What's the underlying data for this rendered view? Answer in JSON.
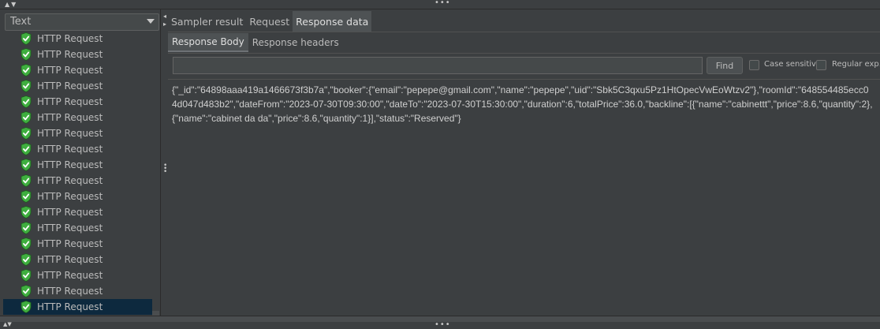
{
  "renderer_select": {
    "value": "Text"
  },
  "tree": {
    "items": [
      "HTTP Request",
      "HTTP Request",
      "HTTP Request",
      "HTTP Request",
      "HTTP Request",
      "HTTP Request",
      "HTTP Request",
      "HTTP Request",
      "HTTP Request",
      "HTTP Request",
      "HTTP Request",
      "HTTP Request",
      "HTTP Request",
      "HTTP Request",
      "HTTP Request",
      "HTTP Request",
      "HTTP Request",
      "HTTP Request"
    ],
    "item_icon": "green-shield-check-icon",
    "selected_index": 17
  },
  "tabs": [
    "Sampler result",
    "Request",
    "Response data"
  ],
  "active_tab": "Response data",
  "subtabs": [
    "Response Body",
    "Response headers"
  ],
  "active_subtab": "Response Body",
  "search": {
    "value": "",
    "find_label": "Find",
    "case_sensitive_label": "Case sensitive",
    "regex_label": "Regular exp."
  },
  "response_body": "{\"_id\":\"64898aaa419a1466673f3b7a\",\"booker\":{\"email\":\"pepepe@gmail.com\",\"name\":\"pepepe\",\"uid\":\"Sbk5C3qxu5Pz1HtOpecVwEoWtzv2\"},\"roomId\":\"648554485ecc04d047d483b2\",\"dateFrom\":\"2023-07-30T09:30:00\",\"dateTo\":\"2023-07-30T15:30:00\",\"duration\":6,\"totalPrice\":36.0,\"backline\":[{\"name\":\"cabinettt\",\"price\":8.6,\"quantity\":2},{\"name\":\"cabinet da da\",\"price\":8.6,\"quantity\":1}],\"status\":\"Reserved\"}",
  "colors": {
    "background": "#3c3f41",
    "selected_row": "#0d293e",
    "shield_green": "#3fae3f",
    "text": "#bbbbbb"
  }
}
